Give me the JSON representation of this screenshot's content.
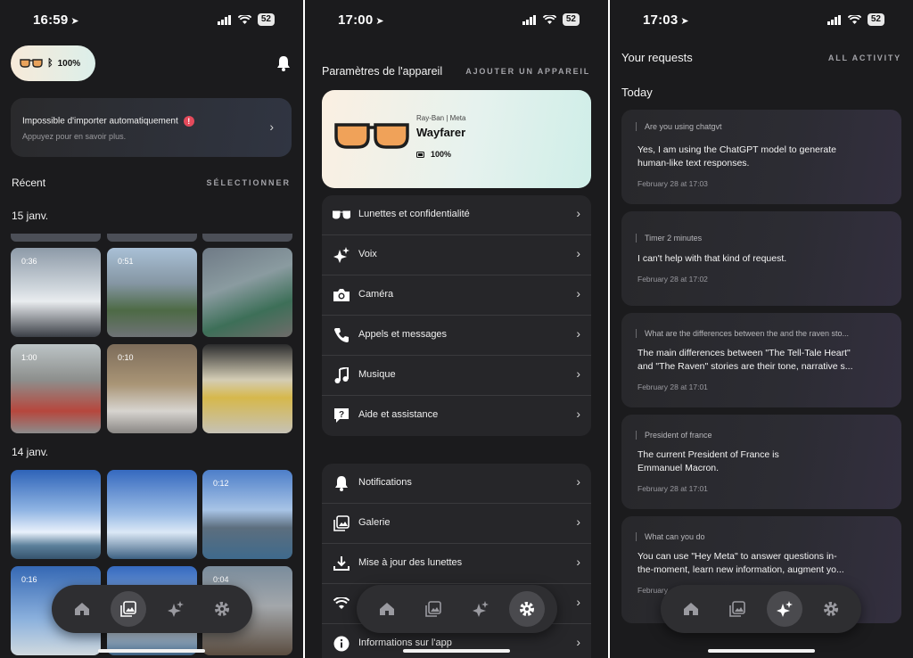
{
  "phone1": {
    "status": {
      "time": "16:59",
      "battery": "52"
    },
    "glasses_battery": "100%",
    "alert": {
      "title": "Impossible d'importer automatiquement",
      "badge": "!",
      "subtitle": "Appuyez pour en savoir plus."
    },
    "recent": {
      "title": "Récent",
      "action": "SÉLECTIONNER"
    },
    "groups": [
      {
        "date": "15 janv.",
        "durations": [
          "0:36",
          "0:51",
          "",
          "1:00",
          "0:10",
          ""
        ]
      },
      {
        "date": "14 janv.",
        "durations": [
          "",
          "",
          "0:12",
          "0:16",
          "",
          "0:04"
        ]
      }
    ]
  },
  "phone2": {
    "status": {
      "time": "17:00",
      "battery": "52"
    },
    "header": {
      "title": "Paramètres de l'appareil",
      "action": "AJOUTER UN APPAREIL"
    },
    "device": {
      "brand": "Ray-Ban | Meta",
      "model": "Wayfarer",
      "battery": "100%"
    },
    "group1": [
      {
        "icon": "glasses-icon",
        "label": "Lunettes et confidentialité"
      },
      {
        "icon": "sparkle-icon",
        "label": "Voix"
      },
      {
        "icon": "camera-icon",
        "label": "Caméra"
      },
      {
        "icon": "phone-icon",
        "label": "Appels et messages"
      },
      {
        "icon": "music-icon",
        "label": "Musique"
      },
      {
        "icon": "help-icon",
        "label": "Aide et assistance"
      }
    ],
    "group2": [
      {
        "icon": "bell-icon",
        "label": "Notifications"
      },
      {
        "icon": "gallery-icon",
        "label": "Galerie"
      },
      {
        "icon": "download-icon",
        "label": "Mise à jour des lunettes"
      },
      {
        "icon": "wifi-icon",
        "label": ""
      },
      {
        "icon": "info-icon",
        "label": "Informations sur l'app"
      }
    ]
  },
  "phone3": {
    "status": {
      "time": "17:03",
      "battery": "52"
    },
    "header": {
      "title": "Your requests",
      "action": "ALL ACTIVITY"
    },
    "section": "Today",
    "requests": [
      {
        "q": "Are you using chatgvt",
        "a1": "Yes, I am using the ChatGPT model to generate",
        "a2": "human-like text responses.",
        "time": "February 28 at 17:03"
      },
      {
        "q": "Timer 2 minutes",
        "a1": "I can't help with that kind of request.",
        "a2": "",
        "time": "February 28 at 17:02"
      },
      {
        "q": "What are the differences between the and the raven sto...",
        "a1": "The main differences between \"The Tell-Tale Heart\"",
        "a2": "and \"The Raven\" stories are their tone, narrative s...",
        "time": "February 28 at 17:01"
      },
      {
        "q": "President of france",
        "a1": "The current President of France is",
        "a2": "Emmanuel Macron.",
        "time": "February 28 at 17:01"
      },
      {
        "q": "What can you do",
        "a1": "You can use \"Hey Meta\" to answer questions in-",
        "a2": "the-moment, learn new information, augment yo...",
        "time": "February"
      }
    ]
  },
  "nav": [
    "home-icon",
    "gallery-icon",
    "sparkle-icon",
    "gear-icon"
  ],
  "colors": {
    "background": "#1b1b1d",
    "alert_badge": "#e44a5b",
    "device_card_start": "#fbf0e2",
    "device_card_end": "#cfeee8"
  }
}
